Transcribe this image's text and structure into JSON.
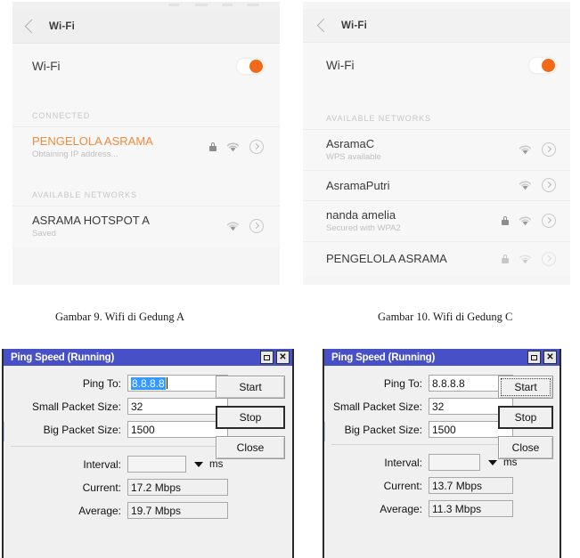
{
  "figures": {
    "left_caption": "Gambar 9. Wifi di Gedung A",
    "right_caption": "Gambar 10. Wifi di Gedung C"
  },
  "wifi_left": {
    "titlebar": {
      "title": "Wi-Fi",
      "back_icon": "back-chevron-icon"
    },
    "toggle": {
      "label": "Wi-Fi",
      "state": "on",
      "accent": "#f26a17"
    },
    "sections": [
      {
        "header": "CONNECTED",
        "rows": [
          {
            "name": "PENGELOLA ASRAMA",
            "subtitle": "Obtaining IP address...",
            "connected": true,
            "lock": true,
            "wifi": true,
            "arrow": true,
            "faded": false
          }
        ]
      },
      {
        "header": "AVAILABLE NETWORKS",
        "rows": [
          {
            "name": "ASRAMA HOTSPOT A",
            "subtitle": "Saved",
            "connected": false,
            "lock": false,
            "wifi": true,
            "arrow": true,
            "faded": false
          }
        ]
      }
    ]
  },
  "wifi_right": {
    "titlebar": {
      "title": "Wi-Fi",
      "back_icon": "back-chevron-icon"
    },
    "toggle": {
      "label": "Wi-Fi",
      "state": "on",
      "accent": "#f26a17"
    },
    "sections": [
      {
        "header": "AVAILABLE NETWORKS",
        "rows": [
          {
            "name": "AsramaC",
            "subtitle": "WPS available",
            "connected": false,
            "lock": false,
            "wifi": true,
            "arrow": true,
            "faded": false
          },
          {
            "name": "AsramaPutri",
            "subtitle": "",
            "connected": false,
            "lock": false,
            "wifi": true,
            "arrow": true,
            "faded": false
          },
          {
            "name": "nanda amelia",
            "subtitle": "Secured with WPA2",
            "connected": false,
            "lock": true,
            "wifi": true,
            "arrow": true,
            "faded": false
          },
          {
            "name": "PENGELOLA ASRAMA",
            "subtitle": "",
            "connected": false,
            "lock": true,
            "wifi": true,
            "arrow": true,
            "faded": true
          }
        ]
      }
    ]
  },
  "ping_left": {
    "title": "Ping Speed (Running)",
    "titlebar_buttons": {
      "maximize": "maximize-icon",
      "close": "✕"
    },
    "fields": [
      {
        "label": "Ping To:",
        "value": "8.8.8.8",
        "selected": true
      },
      {
        "label": "Small Packet Size:",
        "value": "32",
        "selected": false
      },
      {
        "label": "Big Packet Size:",
        "value": "1500",
        "selected": false
      }
    ],
    "buttons": [
      {
        "label": "Start",
        "style": "normal"
      },
      {
        "label": "Stop",
        "style": "default"
      },
      {
        "label": "Close",
        "style": "normal"
      }
    ],
    "interval": {
      "label": "Interval:",
      "value": "",
      "unit": "ms"
    },
    "readouts": [
      {
        "label": "Current:",
        "value": "17.2 Mbps"
      },
      {
        "label": "Average:",
        "value": "19.7 Mbps"
      }
    ]
  },
  "ping_right": {
    "title": "Ping Speed (Running)",
    "titlebar_buttons": {
      "maximize": "maximize-icon",
      "close": "✕"
    },
    "fields": [
      {
        "label": "Ping To:",
        "value": "8.8.8.8",
        "selected": false
      },
      {
        "label": "Small Packet Size:",
        "value": "32",
        "selected": false
      },
      {
        "label": "Big Packet Size:",
        "value": "1500",
        "selected": false
      }
    ],
    "buttons": [
      {
        "label": "Start",
        "style": "focused"
      },
      {
        "label": "Stop",
        "style": "default"
      },
      {
        "label": "Close",
        "style": "normal"
      }
    ],
    "interval": {
      "label": "Interval:",
      "value": "",
      "unit": "ms"
    },
    "readouts": [
      {
        "label": "Current:",
        "value": "13.7 Mbps"
      },
      {
        "label": "Average:",
        "value": "11.3 Mbps"
      }
    ]
  },
  "colors": {
    "dialog_titlebar": "#4850c8",
    "dialog_face": "#f0f0f0",
    "selection": "#3399ff",
    "wifi_accent": "#f26a17",
    "panel_bg": "#f7f7f7"
  }
}
